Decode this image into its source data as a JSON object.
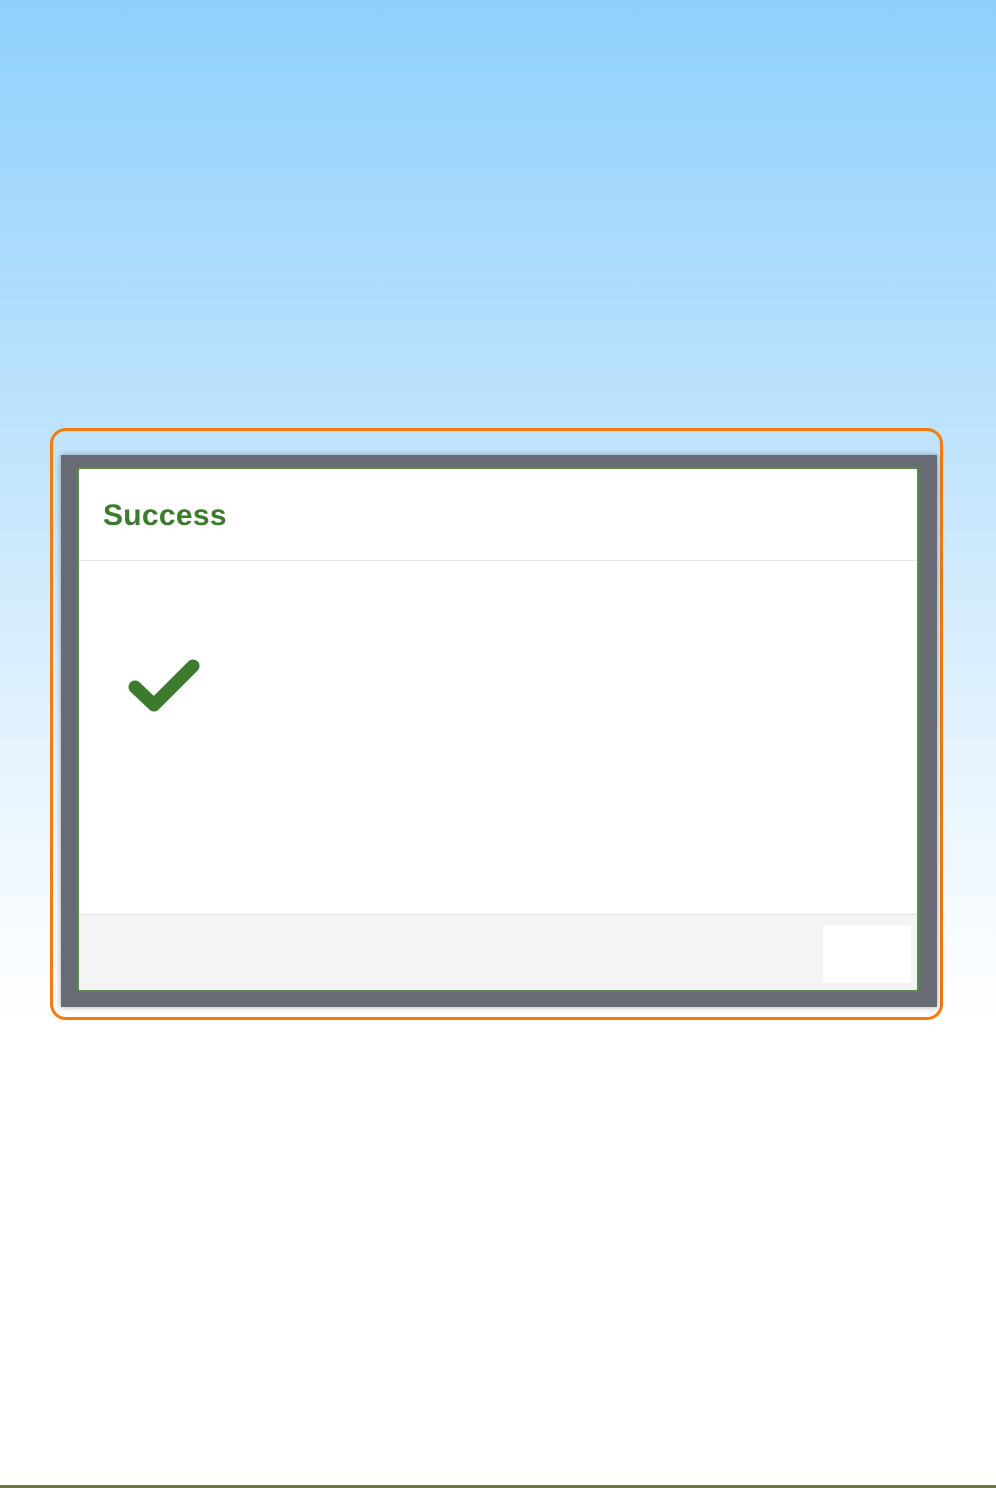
{
  "dialog": {
    "title": "Success",
    "status_icon": "check-icon",
    "footer_button_label": ""
  },
  "colors": {
    "highlight": "#f47b10",
    "success_green": "#3c7a2e",
    "backdrop": "#686a74",
    "footer_bg": "#f4f4f4"
  }
}
